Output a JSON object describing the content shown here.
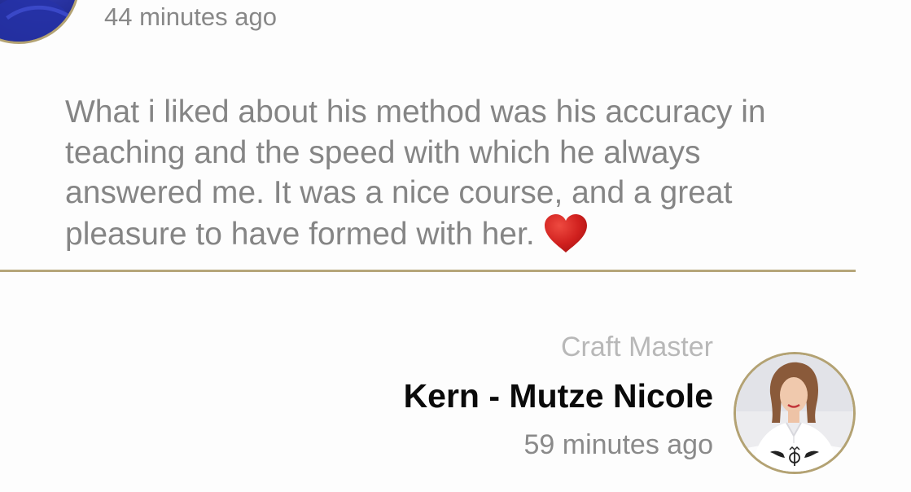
{
  "top_review": {
    "avatar_icon": "user-avatar-icon",
    "timestamp": "44 minutes ago",
    "text": "What i liked about his method was his accuracy in teaching and the speed with which he always answered me. It was a nice course, and a great pleasure to have formed with her.",
    "emoji_icon": "red-heart-icon"
  },
  "reply": {
    "role": "Craft Master",
    "name": "Kern - Mutze Nicole",
    "timestamp": "59 minutes ago",
    "avatar_icon": "profile-photo-avatar-icon",
    "badge_icon": "winged-logo-badge-icon"
  },
  "colors": {
    "accent_gold": "#b6a67a",
    "text_gray": "#858585",
    "role_gray": "#b8b8b8",
    "name_black": "#0a0a0a",
    "heart_red": "#d0201e"
  }
}
